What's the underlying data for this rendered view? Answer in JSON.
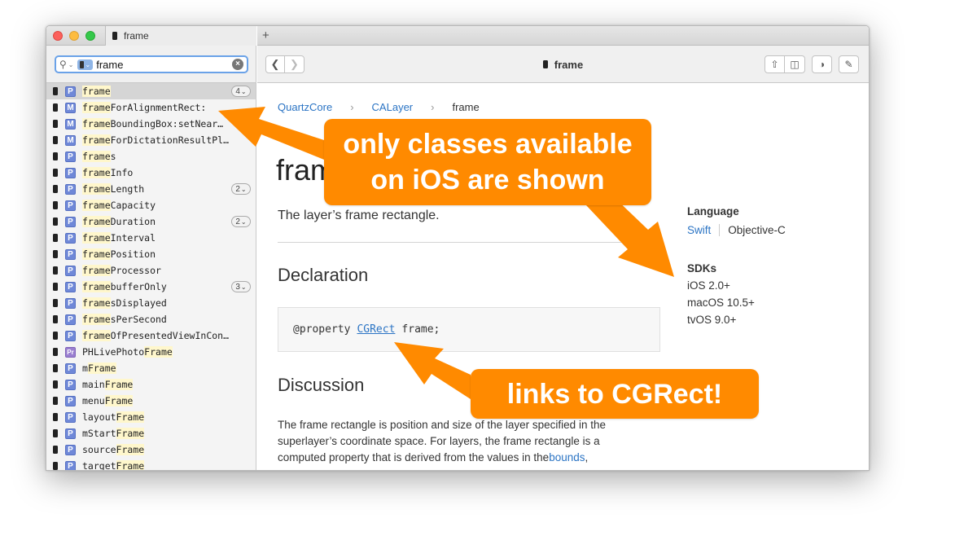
{
  "window": {
    "tab_title": "frame",
    "new_tab": "+",
    "page_title": "frame"
  },
  "search": {
    "value": "frame",
    "search_icon": "magnifier-icon",
    "scope_icon": "iphone-icon",
    "clear_icon": "clear-circle-icon"
  },
  "results": [
    {
      "kind": "P",
      "pre": "",
      "match": "frame",
      "post": "",
      "count": "4",
      "selected": true
    },
    {
      "kind": "M",
      "pre": "",
      "match": "frame",
      "post": "ForAlignmentRect:",
      "count": ""
    },
    {
      "kind": "M",
      "pre": "",
      "match": "frame",
      "post": "BoundingBox:setNear…",
      "count": ""
    },
    {
      "kind": "M",
      "pre": "",
      "match": "frame",
      "post": "ForDictationResultPl…",
      "count": ""
    },
    {
      "kind": "P",
      "pre": "",
      "match": "frame",
      "post": "s",
      "count": ""
    },
    {
      "kind": "P",
      "pre": "",
      "match": "frame",
      "post": "Info",
      "count": ""
    },
    {
      "kind": "P",
      "pre": "",
      "match": "frame",
      "post": "Length",
      "count": "2"
    },
    {
      "kind": "P",
      "pre": "",
      "match": "frame",
      "post": "Capacity",
      "count": ""
    },
    {
      "kind": "P",
      "pre": "",
      "match": "frame",
      "post": "Duration",
      "count": "2"
    },
    {
      "kind": "P",
      "pre": "",
      "match": "frame",
      "post": "Interval",
      "count": ""
    },
    {
      "kind": "P",
      "pre": "",
      "match": "frame",
      "post": "Position",
      "count": ""
    },
    {
      "kind": "P",
      "pre": "",
      "match": "frame",
      "post": "Processor",
      "count": ""
    },
    {
      "kind": "P",
      "pre": "",
      "match": "frame",
      "post": "bufferOnly",
      "count": "3"
    },
    {
      "kind": "P",
      "pre": "",
      "match": "frame",
      "post": "sDisplayed",
      "count": ""
    },
    {
      "kind": "P",
      "pre": "",
      "match": "frame",
      "post": "sPerSecond",
      "count": ""
    },
    {
      "kind": "P",
      "pre": "",
      "match": "frame",
      "post": "OfPresentedViewInCon…",
      "count": ""
    },
    {
      "kind": "Pr",
      "pre": "PHLivePhoto",
      "match": "Frame",
      "post": "",
      "count": ""
    },
    {
      "kind": "P",
      "pre": "m",
      "match": "Frame",
      "post": "",
      "count": ""
    },
    {
      "kind": "P",
      "pre": "main",
      "match": "Frame",
      "post": "",
      "count": ""
    },
    {
      "kind": "P",
      "pre": "menu",
      "match": "Frame",
      "post": "",
      "count": ""
    },
    {
      "kind": "P",
      "pre": "layout",
      "match": "Frame",
      "post": "",
      "count": ""
    },
    {
      "kind": "P",
      "pre": "mStart",
      "match": "Frame",
      "post": "",
      "count": ""
    },
    {
      "kind": "P",
      "pre": "source",
      "match": "Frame",
      "post": "",
      "count": ""
    },
    {
      "kind": "P",
      "pre": "target",
      "match": "Frame",
      "post": "",
      "count": ""
    }
  ],
  "doc": {
    "breadcrumb": [
      "QuartzCore",
      "CALayer",
      "frame"
    ],
    "title": "frame",
    "abstract": "The layer’s frame rectangle.",
    "declaration_heading": "Declaration",
    "code_prefix": "@property",
    "code_link": "CGRect",
    "code_suffix": "frame;",
    "discussion_heading": "Discussion",
    "discussion_line1": "The frame rectangle is position and size of the layer specified in the",
    "discussion_line2": "superlayer’s coordinate space. For layers, the frame rectangle is a",
    "discussion_line3_text": "computed property that is derived from the values in the",
    "discussion_line3_link": "bounds",
    "discussion_line3_end": ","
  },
  "sidebar": {
    "language_heading": "Language",
    "lang_swift": "Swift",
    "lang_objc": "Objective-C",
    "sdks_heading": "SDKs",
    "sdks": [
      "iOS 2.0+",
      "macOS 10.5+",
      "tvOS 9.0+"
    ]
  },
  "annotations": {
    "callout1_line1": "only classes available",
    "callout1_line2": "on iOS are shown",
    "callout2": "links to CGRect!",
    "color": "#ff8a00"
  }
}
